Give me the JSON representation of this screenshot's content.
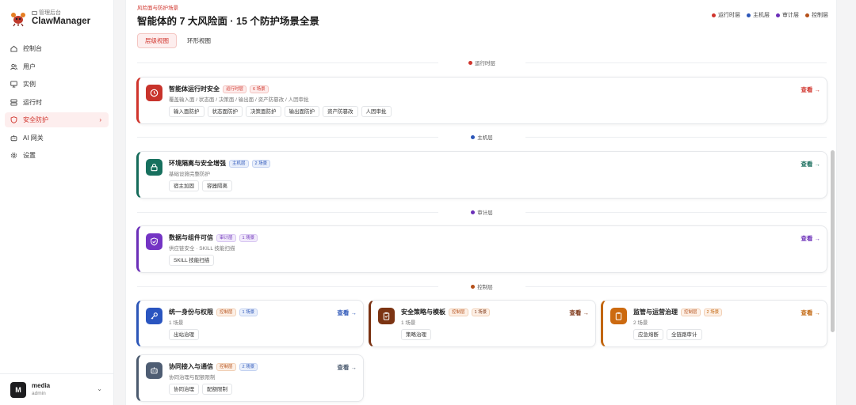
{
  "sidebar": {
    "brand_sub": "管理后台",
    "brand_title": "ClawManager",
    "items": [
      {
        "label": "控制台",
        "icon": "home-icon"
      },
      {
        "label": "用户",
        "icon": "users-icon"
      },
      {
        "label": "实例",
        "icon": "monitor-icon"
      },
      {
        "label": "运行时",
        "icon": "server-icon"
      },
      {
        "label": "安全防护",
        "icon": "shield-icon",
        "active": true
      },
      {
        "label": "AI 网关",
        "icon": "robot-icon"
      },
      {
        "label": "设置",
        "icon": "gear-icon"
      }
    ],
    "user": {
      "initial": "M",
      "name": "media",
      "role": "admin"
    }
  },
  "header": {
    "eyebrow": "风险面与防护场景",
    "title": "智能体的 7 大风险面 · 15 个防护场景全景",
    "legend": [
      {
        "label": "运行时层",
        "color": "#d0342c"
      },
      {
        "label": "主机层",
        "color": "#2c56b8"
      },
      {
        "label": "审计层",
        "color": "#6b2fb8"
      },
      {
        "label": "控制层",
        "color": "#b5501a"
      }
    ]
  },
  "tabs": [
    {
      "label": "层级视图",
      "active": true
    },
    {
      "label": "环形视图",
      "active": false
    }
  ],
  "separators": [
    {
      "label": "运行时层",
      "color": "#d0342c"
    },
    {
      "label": "主机层",
      "color": "#2c56b8"
    },
    {
      "label": "审计层",
      "color": "#6b2fb8"
    },
    {
      "label": "控制层",
      "color": "#b5501a"
    }
  ],
  "cards": [
    {
      "title": "智能体运行时安全",
      "layer": "运行时层",
      "count": "6 场景",
      "desc": "覆盖输入面 / 状态面 / 决策面 / 输出面 / 资产防篡改 / 人因审批",
      "chips": [
        "输入面防护",
        "状态面防护",
        "决策面防护",
        "输出面防护",
        "资产防篡改",
        "人因审批"
      ],
      "view": "查看 →",
      "color": "#d0342c",
      "icon_bg": "#c8332b",
      "icon": "clock-icon"
    },
    {
      "title": "环境隔离与安全增强",
      "layer": "主机层",
      "count": "2 场景",
      "desc": "基础设施完整防护",
      "chips": [
        "宿主加固",
        "容器隔离"
      ],
      "view": "查看 →",
      "color": "#156b5a",
      "icon_bg": "#17705e",
      "icon": "lock-icon"
    },
    {
      "title": "数据与组件可信",
      "layer": "审计层",
      "count": "1 场景",
      "desc": "供应链安全 · SKILL 技能扫描",
      "chips": [
        "SKILL 技能扫描"
      ],
      "view": "查看 →",
      "color": "#6b2fb8",
      "icon_bg": "#7434c4",
      "icon": "shield-check-icon"
    },
    {
      "title": "统一身份与权限",
      "layer": "控制层",
      "count": "1 场景",
      "desc": "1 场景",
      "chips": [
        "出站治理"
      ],
      "view": "查看 →",
      "color": "#2c56b8",
      "icon_bg": "#2a55c0",
      "icon": "key-icon"
    },
    {
      "title": "安全策略与模板",
      "layer": "控制层",
      "count": "1 场景",
      "desc": "1 场景",
      "chips": [
        "策略治理"
      ],
      "view": "查看 →",
      "color": "#7a3212",
      "icon_bg": "#7c3413",
      "icon": "clipboard-icon"
    },
    {
      "title": "监管与运营治理",
      "layer": "控制层",
      "count": "2 场景",
      "desc": "2 场景",
      "chips": [
        "应急熔断",
        "全链路审计"
      ],
      "view": "查看 →",
      "color": "#c2660e",
      "icon_bg": "#cc6a10",
      "icon": "clipboard-icon"
    },
    {
      "title": "协同接入与通信",
      "layer": "控制层",
      "count": "2 场景",
      "desc": "协同治理与配额限制",
      "chips": [
        "协同治理",
        "配额限制"
      ],
      "view": "查看 →",
      "color": "#4b5a6e",
      "icon_bg": "#4e5d73",
      "icon": "robot-icon"
    }
  ]
}
